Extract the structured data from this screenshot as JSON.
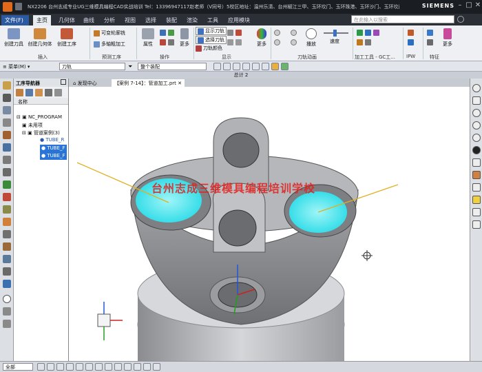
{
  "titlebar": {
    "text": "NX2206 台州志成专业UG三维模具编程CAD实战培训 Tel：13396947117赵老师（V同号）5校区地址：温州乐清、台州椒江三甲、玉环坎门、玉环珠港、玉环沙门、玉环坎门 - 加工",
    "brand": "SIEMENS",
    "min": "–",
    "max": "□",
    "close": "✕"
  },
  "tabs": [
    "文件(F)",
    "主页",
    "几何体",
    "曲线",
    "分析",
    "视图",
    "选择",
    "装配",
    "渲染",
    "工具",
    "应用模块"
  ],
  "search_placeholder": "在此输入以搜索",
  "ribbon": {
    "buttons": [
      "创建刀具",
      "创建几何体",
      "创建工序",
      "属性",
      "更多",
      "更多",
      "播放",
      "速度",
      "更多"
    ],
    "small": [
      "可变轮廓铣",
      "多轴粗加工",
      "显示刀轨",
      "选择刀轨",
      "刀轨颜色"
    ],
    "groups": [
      "插入",
      "预测工序",
      "操作",
      "显示",
      "刀轨动画",
      "加工工具 - GC工...",
      "IPW",
      "特征"
    ]
  },
  "selbar": {
    "menu": "菜单(M)",
    "filter": "刀轨",
    "scope": "整个装配"
  },
  "total_label": "总计 2",
  "navigator": {
    "title": "工序导航器",
    "column": "名称",
    "items": [
      "NC_PROGRAM",
      "未用项",
      "管道案例(3)",
      "TUBE_R",
      "TUBE_F",
      "TUBE_F"
    ]
  },
  "doc_tabs": [
    "发现中心",
    "【案例 7-14】：管道加工.prt"
  ],
  "watermark": "台州志成三维模具编程培训学校",
  "statusbar": {
    "filter": "全部"
  },
  "colors": {
    "file_tab": "#2c5aa0",
    "pocket_cyan": "#2ee6ee",
    "watermark": "#e0201e",
    "selection": "#2a74d8"
  }
}
